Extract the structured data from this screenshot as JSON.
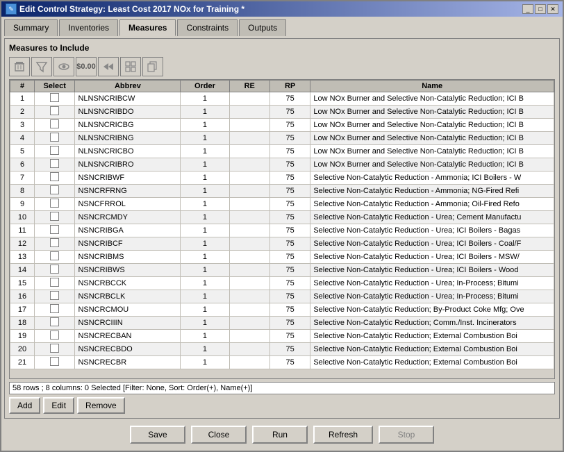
{
  "window": {
    "title": "Edit Control Strategy: Least Cost 2017 NOx for Training *"
  },
  "tabs": [
    {
      "label": "Summary",
      "active": false
    },
    {
      "label": "Inventories",
      "active": false
    },
    {
      "label": "Measures",
      "active": true
    },
    {
      "label": "Constraints",
      "active": false
    },
    {
      "label": "Outputs",
      "active": false
    }
  ],
  "section": {
    "label": "Measures to Include"
  },
  "toolbar": {
    "delete_label": "🗑",
    "filter_label": "⬛",
    "eye_label": "👁",
    "dollar_label": "$",
    "rewind_label": "⏮",
    "grid_label": "⊞",
    "copy_label": "⧉"
  },
  "table": {
    "headers": [
      "#",
      "Select",
      "Abbrev",
      "Order",
      "RE",
      "RP",
      "Name"
    ],
    "rows": [
      [
        1,
        "",
        "NLNSNCRIBCW",
        1,
        "",
        75,
        "Low NOx Burner and Selective Non-Catalytic Reduction; ICI B"
      ],
      [
        2,
        "",
        "NLNSNCRIBDO",
        1,
        "",
        75,
        "Low NOx Burner and Selective Non-Catalytic Reduction; ICI B"
      ],
      [
        3,
        "",
        "NLNSNCRICBG",
        1,
        "",
        75,
        "Low NOx Burner and Selective Non-Catalytic Reduction; ICI B"
      ],
      [
        4,
        "",
        "NLNSNCRIBNG",
        1,
        "",
        75,
        "Low NOx Burner and Selective Non-Catalytic Reduction; ICI B"
      ],
      [
        5,
        "",
        "NLNSNCRICBO",
        1,
        "",
        75,
        "Low NOx Burner and Selective Non-Catalytic Reduction; ICI B"
      ],
      [
        6,
        "",
        "NLNSNCRIBRO",
        1,
        "",
        75,
        "Low NOx Burner and Selective Non-Catalytic Reduction; ICI B"
      ],
      [
        7,
        "",
        "NSNCRIBWF",
        1,
        "",
        75,
        "Selective Non-Catalytic Reduction - Ammonia; ICI Boilers - W"
      ],
      [
        8,
        "",
        "NSNCRFRNG",
        1,
        "",
        75,
        "Selective Non-Catalytic Reduction - Ammonia; NG-Fired Refi"
      ],
      [
        9,
        "",
        "NSNCFRROL",
        1,
        "",
        75,
        "Selective Non-Catalytic Reduction - Ammonia; Oil-Fired Refo"
      ],
      [
        10,
        "",
        "NSNCRCMDY",
        1,
        "",
        75,
        "Selective Non-Catalytic Reduction - Urea; Cement Manufactu"
      ],
      [
        11,
        "",
        "NSNCRIBGA",
        1,
        "",
        75,
        "Selective Non-Catalytic Reduction - Urea; ICI Boilers - Bagas"
      ],
      [
        12,
        "",
        "NSNCRIBCF",
        1,
        "",
        75,
        "Selective Non-Catalytic Reduction - Urea; ICI Boilers - Coal/F"
      ],
      [
        13,
        "",
        "NSNCRIBMS",
        1,
        "",
        75,
        "Selective Non-Catalytic Reduction - Urea; ICI Boilers - MSW/"
      ],
      [
        14,
        "",
        "NSNCRIBWS",
        1,
        "",
        75,
        "Selective Non-Catalytic Reduction - Urea; ICI Boilers - Wood"
      ],
      [
        15,
        "",
        "NSNCRBCCK",
        1,
        "",
        75,
        "Selective Non-Catalytic Reduction - Urea; In-Process; Bitumi"
      ],
      [
        16,
        "",
        "NSNCRBCLK",
        1,
        "",
        75,
        "Selective Non-Catalytic Reduction - Urea; In-Process; Bitumi"
      ],
      [
        17,
        "",
        "NSNCRCMOU",
        1,
        "",
        75,
        "Selective Non-Catalytic Reduction; By-Product Coke Mfg; Ove"
      ],
      [
        18,
        "",
        "NSNCRCIIIN",
        1,
        "",
        75,
        "Selective Non-Catalytic Reduction; Comm./Inst. Incinerators"
      ],
      [
        19,
        "",
        "NSNCRECBAN",
        1,
        "",
        75,
        "Selective Non-Catalytic Reduction; External Combustion Boi"
      ],
      [
        20,
        "",
        "NSNCRECBDO",
        1,
        "",
        75,
        "Selective Non-Catalytic Reduction; External Combustion Boi"
      ],
      [
        21,
        "",
        "NSNCRECBR",
        1,
        "",
        75,
        "Selective Non-Catalytic Reduction; External Combustion Boi"
      ]
    ]
  },
  "status": {
    "text": "58 rows ; 8 columns: 0 Selected [Filter: None, Sort: Order(+), Name(+)]"
  },
  "bottom_buttons": [
    {
      "label": "Add",
      "disabled": false
    },
    {
      "label": "Edit",
      "disabled": false
    },
    {
      "label": "Remove",
      "disabled": false
    }
  ],
  "footer_buttons": [
    {
      "label": "Save",
      "disabled": false
    },
    {
      "label": "Close",
      "disabled": false
    },
    {
      "label": "Run",
      "disabled": false
    },
    {
      "label": "Refresh",
      "disabled": false
    },
    {
      "label": "Stop",
      "disabled": true
    }
  ]
}
